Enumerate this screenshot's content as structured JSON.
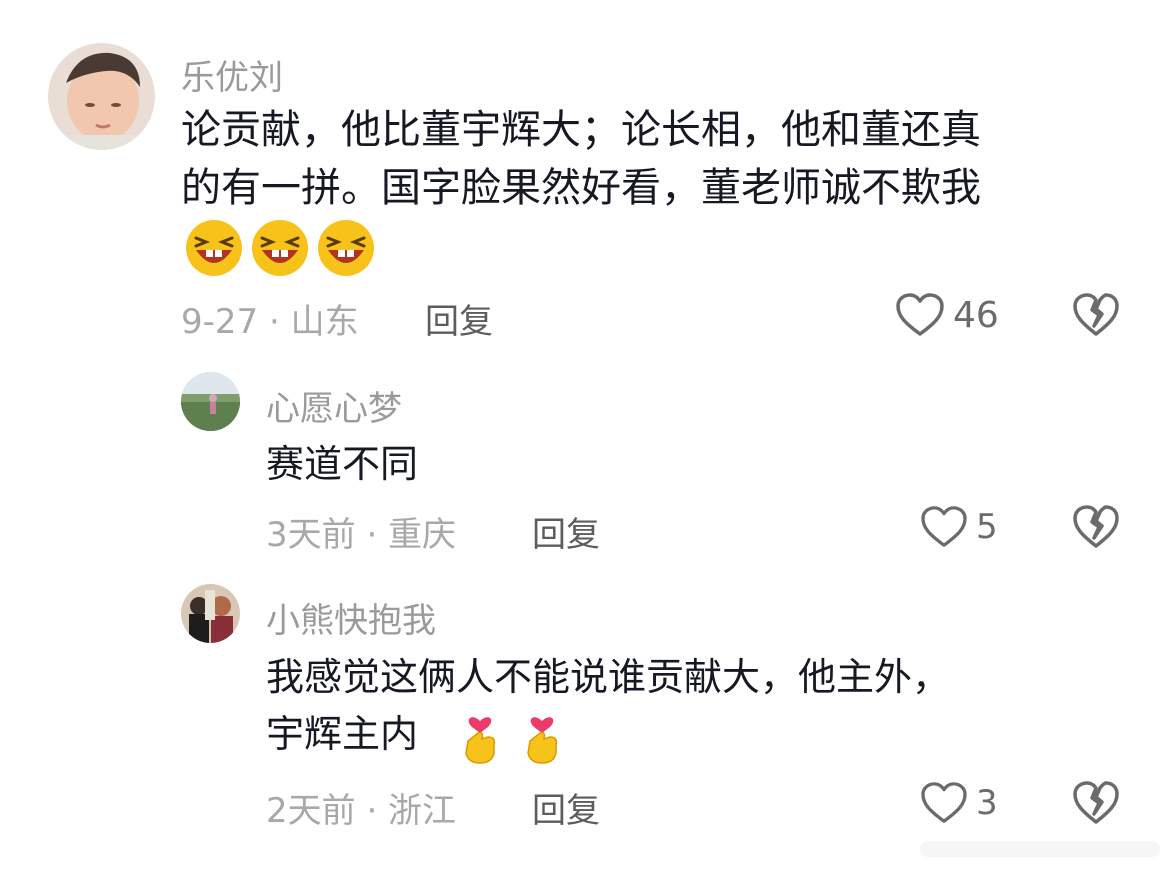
{
  "comments": [
    {
      "username": "乐优刘",
      "text_line1": "论贡献，他比董宇辉大；论长相，他和董还真",
      "text_line2": "的有一拼。国字脸果然好看，董老师诚不欺我",
      "meta": "9-27 · 山东",
      "reply_label": "回复",
      "likes": "46",
      "emoji": [
        "laughing-face",
        "laughing-face",
        "laughing-face"
      ]
    }
  ],
  "replies": [
    {
      "username": "心愿心梦",
      "text_line1": "赛道不同",
      "meta": "3天前 · 重庆",
      "reply_label": "回复",
      "likes": "5"
    },
    {
      "username": "小熊快抱我",
      "text_line1": "我感觉这俩人不能说谁贡献大，他主外，",
      "text_line2": "宇辉主内",
      "meta": "2天前 · 浙江",
      "reply_label": "回复",
      "likes": "3",
      "emoji": [
        "finger-heart",
        "finger-heart"
      ]
    }
  ],
  "colors": {
    "username": "#9a9a9a",
    "text": "#161823",
    "meta": "#a8a8a8",
    "icon": "#6b6b6b",
    "emoji_yellow": "#f7c21a",
    "emoji_mouth": "#b5321d"
  }
}
